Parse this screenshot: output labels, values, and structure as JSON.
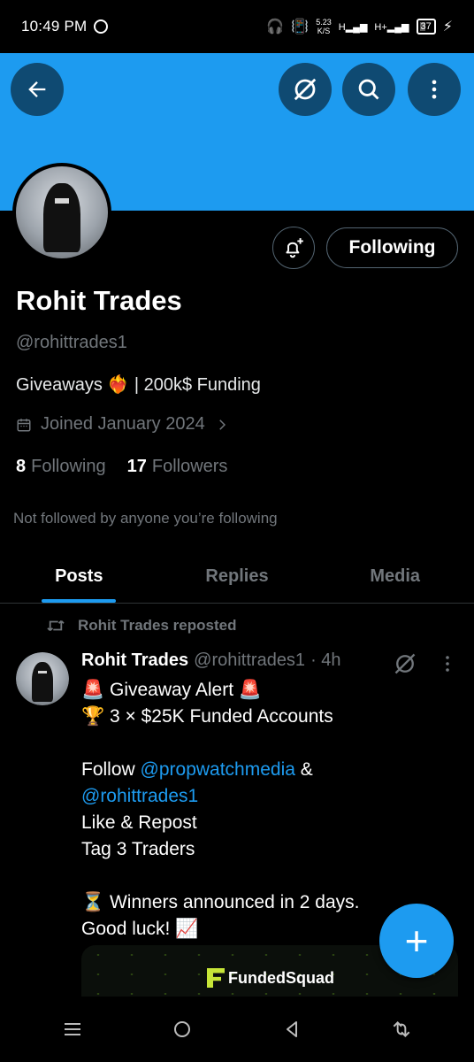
{
  "status_bar": {
    "time": "10:49 PM",
    "network_speed": "5.23",
    "network_unit": "K/S",
    "signal_label_1": "H",
    "signal_label_2": "H+",
    "battery": "37"
  },
  "header": {
    "back_icon": "arrow-left-icon",
    "grok_icon": "grok-icon",
    "search_icon": "search-icon",
    "more_icon": "more-vertical-icon",
    "banner_color": "#1d9bf0"
  },
  "profile": {
    "name": "Rohit Trades",
    "handle": "@rohittrades1",
    "bio": "Giveaways ❤️‍🔥 | 200k$ Funding",
    "joined": "Joined January 2024",
    "following_count": "8",
    "following_label": "Following",
    "followers_count": "17",
    "followers_label": "Followers",
    "not_followed_text": "Not followed by anyone you’re following",
    "following_button": "Following"
  },
  "tabs": [
    {
      "label": "Posts",
      "active": true
    },
    {
      "label": "Replies",
      "active": false
    },
    {
      "label": "Media",
      "active": false
    }
  ],
  "post": {
    "repost_label": "Rohit Trades reposted",
    "author_name": "Rohit Trades",
    "author_handle": "@rohittrades1",
    "time": "· 4h",
    "lines": {
      "l1": "🚨 Giveaway Alert 🚨",
      "l2": "🏆 3 × $25K Funded Accounts",
      "l3_prefix": "Follow ",
      "l3_mention": "@propwatchmedia",
      "l3_suffix": " &",
      "l4_mention": "@rohittrades1",
      "l5": "Like & Repost",
      "l6": "Tag 3 Traders",
      "l7": "⏳ Winners announced in 2 days.",
      "l8": "Good luck! 📈"
    },
    "media_brand": "FundedSquad"
  },
  "fab_label": "+",
  "colors": {
    "accent": "#1d9bf0",
    "muted": "#71767b",
    "background": "#000000"
  }
}
